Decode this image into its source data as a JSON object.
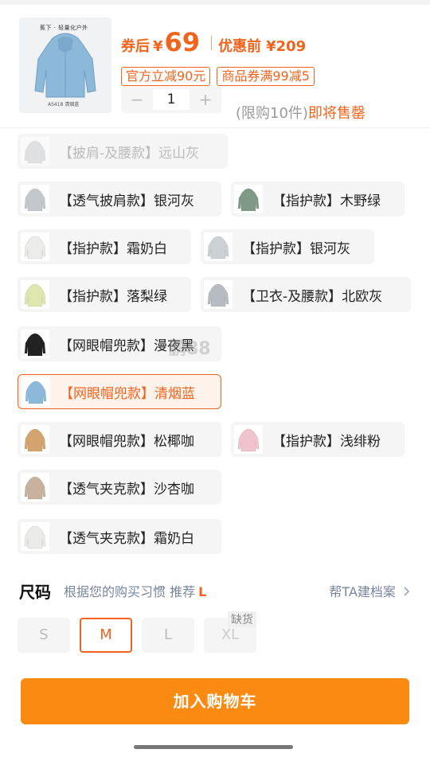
{
  "product": {
    "thumb_brand": "蕉下 · 轻量化户外",
    "thumb_code": "AS418 清烟蓝",
    "price_label": "券后",
    "currency": "¥",
    "price": "69",
    "original_label": "优惠前",
    "original_price": "¥209",
    "coupons": [
      "官方立减90元",
      "商品券满99减5"
    ],
    "quantity": "1",
    "minus": "−",
    "plus": "+",
    "limit_text": "(限购10件)",
    "limit_hot": "即将售罄"
  },
  "variants": [
    {
      "label": "【披肩-及腰款】远山灰",
      "color": "#c9ccd1",
      "state": "disabled"
    },
    {
      "label": "【透气披肩款】银河灰",
      "color": "#c4c7cc",
      "state": "normal"
    },
    {
      "label": "【指护款】木野绿",
      "color": "#7e9a86",
      "state": "normal"
    },
    {
      "label": "【指护款】霜奶白",
      "color": "#ececea",
      "state": "normal"
    },
    {
      "label": "【指护款】银河灰",
      "color": "#cdd0d4",
      "state": "normal"
    },
    {
      "label": "【指护款】落梨绿",
      "color": "#dfe6ae",
      "state": "normal"
    },
    {
      "label": "【卫衣-及腰款】北欧灰",
      "color": "#b8bcc2",
      "state": "normal"
    },
    {
      "label": "【网眼帽兜款】漫夜黑",
      "color": "#222222",
      "state": "normal"
    },
    {
      "label": "【网眼帽兜款】清烟蓝",
      "color": "#8cb9da",
      "state": "selected"
    },
    {
      "label": "【网眼帽兜款】松椰咖",
      "color": "#d4a46e",
      "state": "normal"
    },
    {
      "label": "【指护款】浅绯粉",
      "color": "#f1c3cf",
      "state": "normal"
    },
    {
      "label": "【透气夹克款】沙杏咖",
      "color": "#c8b29e",
      "state": "normal"
    },
    {
      "label": "【透气夹克款】霜奶白",
      "color": "#ebebea",
      "state": "normal"
    }
  ],
  "watermark": "鹏88",
  "size": {
    "title": "尺码",
    "recommend_text": "根据您的购买习惯 推荐",
    "recommend_value": "L",
    "archive_link": "帮TA建档案",
    "archive_chevron": "chevron-right-icon",
    "options": [
      {
        "label": "S",
        "state": "normal"
      },
      {
        "label": "M",
        "state": "selected"
      },
      {
        "label": "L",
        "state": "normal"
      },
      {
        "label": "XL",
        "state": "out-of-stock"
      }
    ],
    "out_of_stock_tag": "缺货"
  },
  "cart_button": "加入购物车",
  "colors": {
    "accent": "#f0641e",
    "cart": "#fb8a12"
  }
}
